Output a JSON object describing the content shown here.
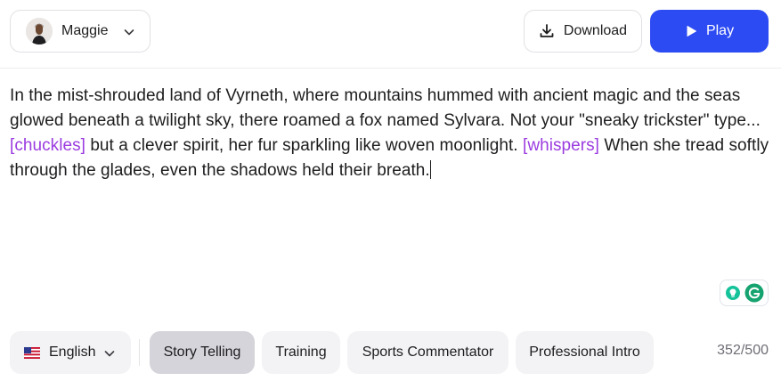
{
  "voice": {
    "name": "Maggie",
    "avatar_icon": "person-avatar"
  },
  "actions": {
    "download_label": "Download",
    "play_label": "Play"
  },
  "colors": {
    "play_bg": "#2d4bf2",
    "tag": "#9b3ce0",
    "active_chip": "#d4d4da"
  },
  "editor": {
    "seg1": "In the mist-shrouded land of Vyrneth, where mountains hummed with ancient magic and the seas glowed beneath a twilight sky, there roamed a fox named Sylvara. Not your \"sneaky trickster\" type... ",
    "tag1": "[chuckles]",
    "seg2": " but a clever spirit, her fur sparkling like woven moonlight. ",
    "tag2": "[whispers]",
    "seg3": " When she tread softly through the glades, even the shadows held their breath."
  },
  "language": {
    "flag": "us-flag",
    "label": "English"
  },
  "presets": [
    "Story Telling",
    "Training",
    "Sports Commentator",
    "Professional Intro"
  ],
  "active_preset": "Story Telling",
  "char_count": "352/500"
}
